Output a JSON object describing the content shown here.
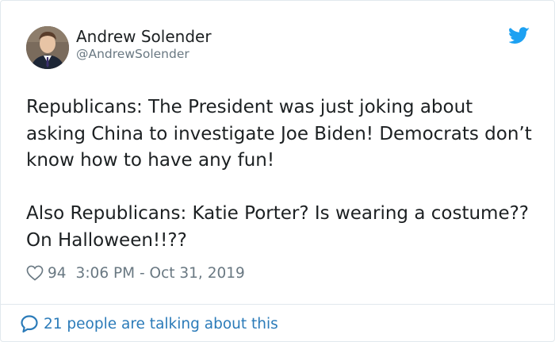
{
  "author": {
    "name": "Andrew Solender",
    "handle": "@AndrewSolender"
  },
  "tweet": {
    "paragraphs": [
      "Republicans: The President was just joking about asking China to investigate Joe Biden! Democrats don’t know how to have any fun!",
      "Also Republicans: Katie Porter? Is wearing a costume?? On Halloween!!??"
    ],
    "likes": "94",
    "timestamp": "3:06 PM - Oct 31, 2019"
  },
  "footer": {
    "conversation": "21 people are talking about this"
  },
  "icons": {
    "brand": "twitter-bird-icon",
    "like": "heart-icon",
    "reply": "speech-bubble-icon"
  },
  "colors": {
    "brand": "#1da1f2",
    "link": "#2b7bb9",
    "muted": "#697882",
    "text": "#1c2022",
    "border": "#e1e8ed"
  }
}
